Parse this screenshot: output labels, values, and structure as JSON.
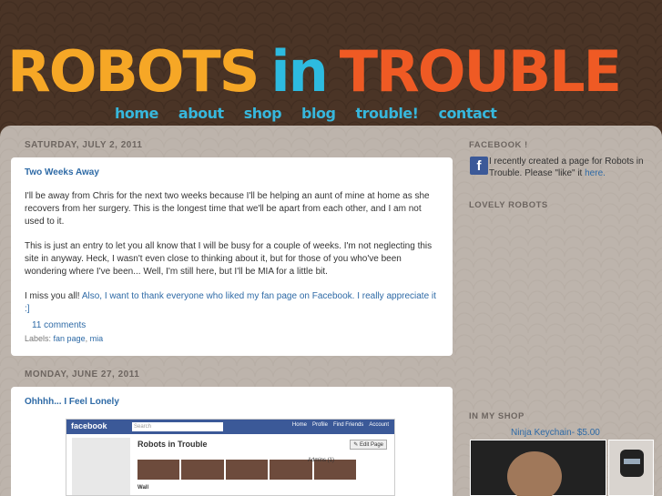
{
  "header": {
    "title_word1": "ROBOTS",
    "title_word2": "in",
    "title_word3": "TROUBLE",
    "nav": [
      {
        "label": "home"
      },
      {
        "label": "about"
      },
      {
        "label": "shop"
      },
      {
        "label": "blog"
      },
      {
        "label": "trouble!"
      },
      {
        "label": "contact"
      }
    ]
  },
  "posts": [
    {
      "date": "SATURDAY, JULY 2, 2011",
      "title": "Two Weeks Away",
      "paragraphs": [
        "I'll be away from Chris for the next two weeks because I'll be helping an aunt of mine at home as she recovers from her surgery. This is the longest time that we'll be apart from each other, and I am not used to it.",
        "This is just an entry to let you all know that I will be busy for a couple of weeks. I'm not neglecting this site in anyway. Heck, I wasn't even close to thinking about it, but for those of you who've been wondering where I've been... Well, I'm still here, but I'll be MIA for a little bit."
      ],
      "last_para_plain": "I miss you all! ",
      "last_para_link": "Also, I want to thank everyone who liked my fan page on Facebook. I really appreciate it :]",
      "comments": "11 comments",
      "labels_prefix": "Labels:",
      "labels": [
        "fan page",
        "mia"
      ]
    },
    {
      "date": "MONDAY, JUNE 27, 2011",
      "title": "Ohhhh... I Feel Lonely",
      "screenshot": {
        "logo": "facebook",
        "search_placeholder": "Search",
        "nav": [
          "Home",
          "Profile",
          "Find Friends",
          "Account"
        ],
        "page_name": "Robots in Trouble",
        "edit_button": "✎ Edit Page",
        "admins": "Admins (1)",
        "wall": "Wall"
      }
    }
  ],
  "sidebar": {
    "facebook_heading": "FACEBOOK !",
    "facebook_text": "I recently created a page for Robots in Trouble. Please \"like\" it ",
    "facebook_link": "here.",
    "lovely_heading": "LOVELY ROBOTS",
    "shop_heading": "IN MY SHOP",
    "shop_item": "Ninja Keychain- $5.00"
  },
  "colors": {
    "brand_orange": "#f6a726",
    "brand_blue": "#2dbbe0",
    "brand_red": "#ef5a24",
    "link": "#2e6aa6",
    "facebook_blue": "#3b5998"
  }
}
